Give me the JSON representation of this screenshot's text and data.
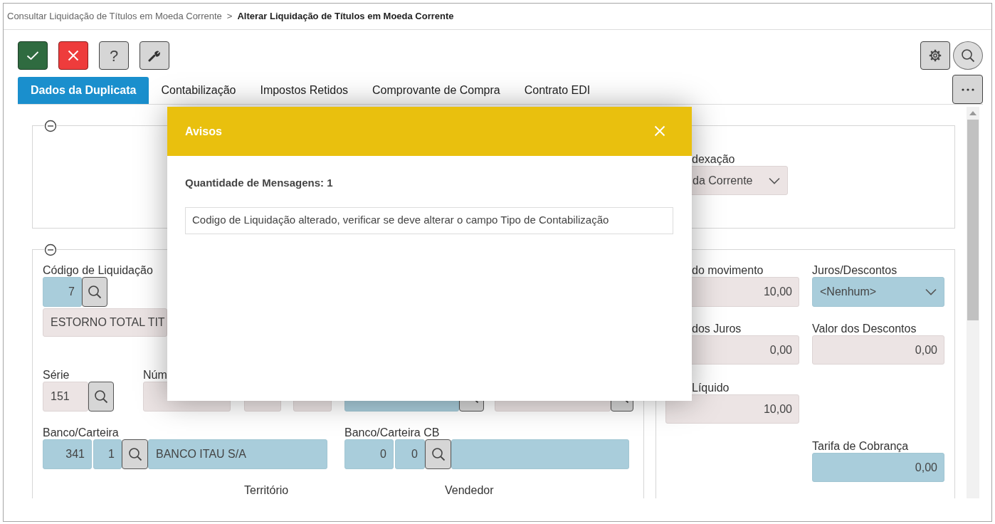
{
  "breadcrumb": {
    "parent": "Consultar Liquidação de Títulos em Moeda Corrente",
    "separator": ">",
    "current": "Alterar Liquidação de Títulos em Moeda Corrente"
  },
  "toolbar": [
    {
      "kind": "confirm"
    },
    {
      "kind": "cancel"
    },
    {
      "kind": "help",
      "label": "?"
    },
    {
      "kind": "tools"
    }
  ],
  "top_right_buttons": [
    {
      "kind": "settings"
    },
    {
      "kind": "search"
    }
  ],
  "tabs": [
    {
      "label": "Dados da Duplicata",
      "selected": true
    },
    {
      "label": "Contabilização",
      "selected": false
    },
    {
      "label": "Impostos Retidos",
      "selected": false
    },
    {
      "label": "Comprovante de Compra",
      "selected": false
    },
    {
      "label": "Contrato EDI",
      "selected": false
    }
  ],
  "top_section": {
    "groups": [
      {
        "label": "dexação",
        "controls": [
          {
            "kind": "select",
            "value": "da Corrente",
            "readonly": true
          }
        ]
      }
    ]
  },
  "left_section": {
    "groups": [
      {
        "label": "Código de Liquidação",
        "controls": [
          {
            "kind": "text",
            "value": "7",
            "readonly": false
          },
          {
            "kind": "lookup"
          }
        ]
      },
      {
        "controls": [
          {
            "kind": "text",
            "value": "ESTORNO TOTAL TIT",
            "readonly": true
          }
        ]
      },
      {
        "label": "Série",
        "controls": [
          {
            "kind": "text",
            "value": "151",
            "readonly": true
          },
          {
            "kind": "lookup"
          }
        ]
      },
      {
        "label": "Núm",
        "controls": [
          {
            "kind": "text",
            "readonly": true
          },
          {
            "kind": "text",
            "readonly": true
          },
          {
            "kind": "text",
            "readonly": true
          },
          {
            "kind": "text",
            "readonly": false
          },
          {
            "kind": "lookup"
          },
          {
            "kind": "text",
            "readonly": true
          },
          {
            "kind": "lookup"
          }
        ]
      },
      {
        "label": "Banco/Carteira",
        "controls": [
          {
            "kind": "text",
            "value": "341",
            "readonly": false
          },
          {
            "kind": "text",
            "value": "1",
            "readonly": false
          },
          {
            "kind": "lookup"
          },
          {
            "kind": "text",
            "value": "BANCO ITAU S/A",
            "readonly": false
          }
        ]
      },
      {
        "label": "Banco/Carteira CB",
        "controls": [
          {
            "kind": "text",
            "value": "0",
            "readonly": false
          },
          {
            "kind": "text",
            "value": "0",
            "readonly": false
          },
          {
            "kind": "lookup"
          },
          {
            "kind": "text",
            "readonly": false
          }
        ]
      },
      {
        "label": "Território"
      },
      {
        "label": "Vendedor"
      }
    ]
  },
  "right_section": {
    "groups": [
      {
        "label": "do movimento",
        "controls": [
          {
            "kind": "text",
            "value": "10,00",
            "readonly": true
          }
        ]
      },
      {
        "label": "Juros/Descontos",
        "controls": [
          {
            "kind": "select",
            "value": "<Nenhum>",
            "readonly": false
          }
        ]
      },
      {
        "label": "dos Juros",
        "controls": [
          {
            "kind": "text",
            "value": "0,00",
            "readonly": true
          }
        ]
      },
      {
        "label": "Valor dos Descontos",
        "controls": [
          {
            "kind": "text",
            "value": "0,00",
            "readonly": true
          }
        ]
      },
      {
        "label": "Líquido",
        "controls": [
          {
            "kind": "text",
            "value": "10,00",
            "readonly": true
          }
        ]
      },
      {
        "label": "Tarifa de Cobrança",
        "controls": [
          {
            "kind": "text",
            "value": "0,00",
            "readonly": false
          }
        ]
      }
    ]
  },
  "dialog": {
    "title": "Avisos",
    "count": "Quantidade de Mensagens: 1",
    "messages": [
      "Codigo de Liquidação alterado, verificar se deve alterar o campo Tipo de Contabilização"
    ]
  }
}
